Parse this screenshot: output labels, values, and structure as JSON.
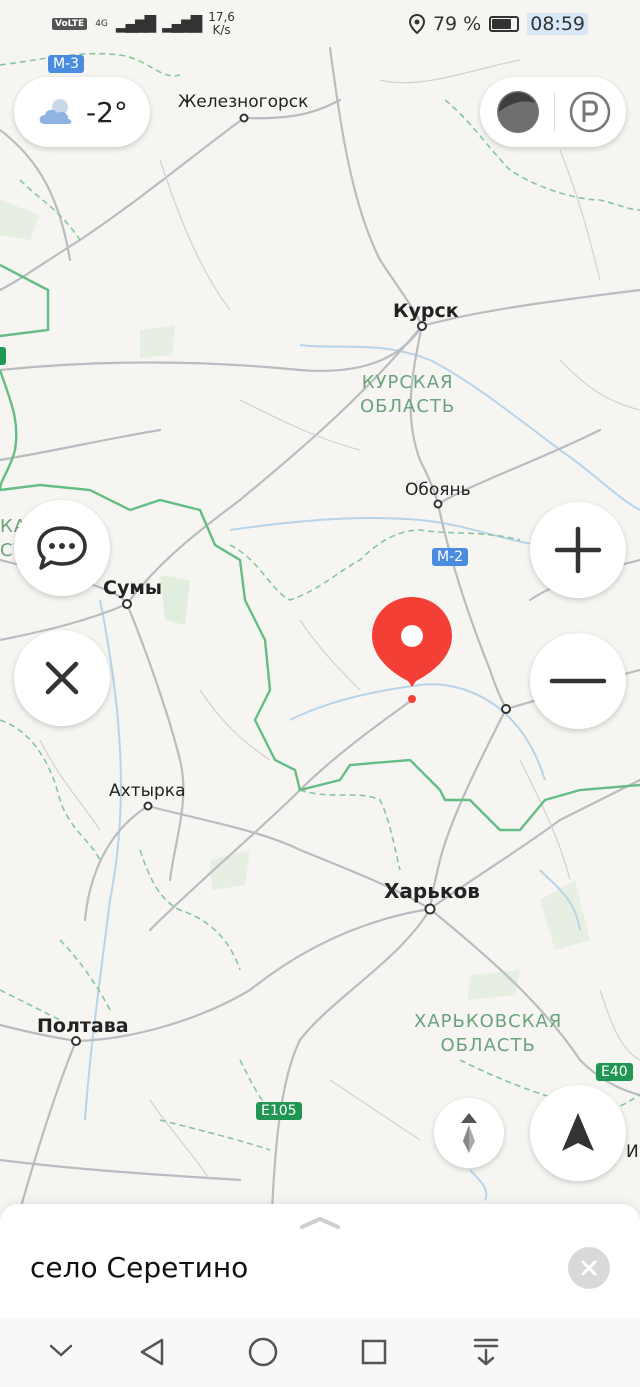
{
  "status_bar": {
    "network": "VoLTE",
    "network_gen": "4G",
    "speed_value": "17,6",
    "speed_unit": "K/s",
    "battery": "79 %",
    "battery_level": 0.79,
    "time": "08:59"
  },
  "weather": {
    "temperature": "-2°",
    "icon": "cloud-sun-icon"
  },
  "map": {
    "cities": {
      "zheleznogorsk": "Железногорск",
      "kursk": "Курск",
      "oboyan": "Обоянь",
      "sumy": "Сумы",
      "akhtyrka": "Ахтырка",
      "kharkov": "Харьков",
      "poltava": "Полтава"
    },
    "regions": {
      "kursk_line1": "КУРСКАЯ",
      "kursk_line2": "ОБЛАСТЬ",
      "kharkov_line1": "ХАРЬКОВСКАЯ",
      "kharkov_line2": "ОБЛАСТЬ",
      "left_clip_line1": "КАЯ",
      "left_clip_line2": "СТЬ",
      "right_clip": "И"
    },
    "road_shields": {
      "m3": "М-3",
      "m2": "М-2",
      "e105": "E105",
      "e40": "E40"
    },
    "colors": {
      "border": "#63bd84",
      "road": "#b9bcc0",
      "pin": "#f43f37",
      "shield_blue": "#4a8de0",
      "shield_green": "#219653"
    }
  },
  "controls": {
    "zoom_in": "+",
    "zoom_out": "−"
  },
  "bottom_sheet": {
    "title": "село Серетино"
  }
}
